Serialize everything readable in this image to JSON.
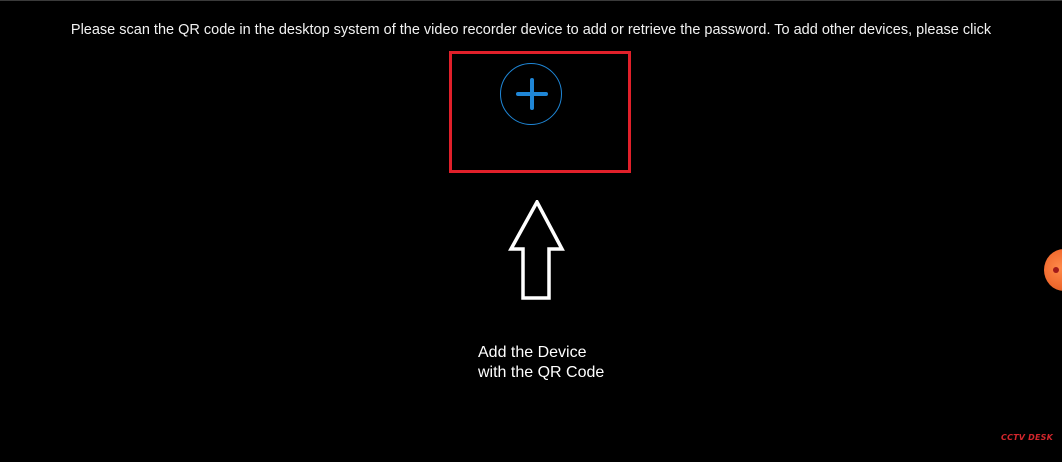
{
  "instruction_text": "Please scan the QR code in the desktop system of the video recorder device to add or retrieve the password. To add other devices, please click",
  "add_button": {
    "icon": "plus-icon",
    "accent_color": "#1f86d6"
  },
  "annotation": {
    "highlight_color": "#e0202a",
    "arrow": "up-arrow-outline",
    "caption_line1": "Add the Device",
    "caption_line2": "with the QR Code"
  },
  "watermark": "CCTV DESK"
}
